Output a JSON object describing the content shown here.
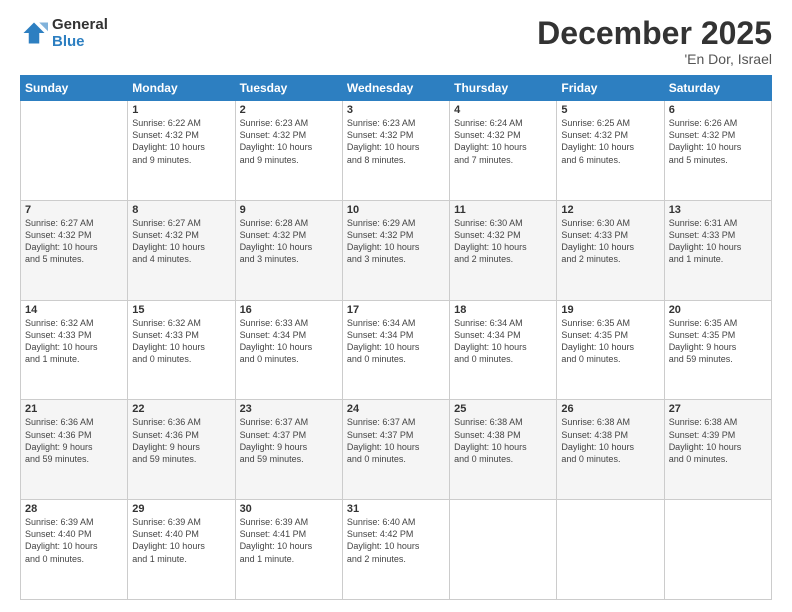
{
  "logo": {
    "line1": "General",
    "line2": "Blue"
  },
  "header": {
    "title": "December 2025",
    "location": "'En Dor, Israel"
  },
  "weekdays": [
    "Sunday",
    "Monday",
    "Tuesday",
    "Wednesday",
    "Thursday",
    "Friday",
    "Saturday"
  ],
  "weeks": [
    [
      {
        "day": "",
        "info": ""
      },
      {
        "day": "1",
        "info": "Sunrise: 6:22 AM\nSunset: 4:32 PM\nDaylight: 10 hours\nand 9 minutes."
      },
      {
        "day": "2",
        "info": "Sunrise: 6:23 AM\nSunset: 4:32 PM\nDaylight: 10 hours\nand 9 minutes."
      },
      {
        "day": "3",
        "info": "Sunrise: 6:23 AM\nSunset: 4:32 PM\nDaylight: 10 hours\nand 8 minutes."
      },
      {
        "day": "4",
        "info": "Sunrise: 6:24 AM\nSunset: 4:32 PM\nDaylight: 10 hours\nand 7 minutes."
      },
      {
        "day": "5",
        "info": "Sunrise: 6:25 AM\nSunset: 4:32 PM\nDaylight: 10 hours\nand 6 minutes."
      },
      {
        "day": "6",
        "info": "Sunrise: 6:26 AM\nSunset: 4:32 PM\nDaylight: 10 hours\nand 5 minutes."
      }
    ],
    [
      {
        "day": "7",
        "info": "Sunrise: 6:27 AM\nSunset: 4:32 PM\nDaylight: 10 hours\nand 5 minutes."
      },
      {
        "day": "8",
        "info": "Sunrise: 6:27 AM\nSunset: 4:32 PM\nDaylight: 10 hours\nand 4 minutes."
      },
      {
        "day": "9",
        "info": "Sunrise: 6:28 AM\nSunset: 4:32 PM\nDaylight: 10 hours\nand 3 minutes."
      },
      {
        "day": "10",
        "info": "Sunrise: 6:29 AM\nSunset: 4:32 PM\nDaylight: 10 hours\nand 3 minutes."
      },
      {
        "day": "11",
        "info": "Sunrise: 6:30 AM\nSunset: 4:32 PM\nDaylight: 10 hours\nand 2 minutes."
      },
      {
        "day": "12",
        "info": "Sunrise: 6:30 AM\nSunset: 4:33 PM\nDaylight: 10 hours\nand 2 minutes."
      },
      {
        "day": "13",
        "info": "Sunrise: 6:31 AM\nSunset: 4:33 PM\nDaylight: 10 hours\nand 1 minute."
      }
    ],
    [
      {
        "day": "14",
        "info": "Sunrise: 6:32 AM\nSunset: 4:33 PM\nDaylight: 10 hours\nand 1 minute."
      },
      {
        "day": "15",
        "info": "Sunrise: 6:32 AM\nSunset: 4:33 PM\nDaylight: 10 hours\nand 0 minutes."
      },
      {
        "day": "16",
        "info": "Sunrise: 6:33 AM\nSunset: 4:34 PM\nDaylight: 10 hours\nand 0 minutes."
      },
      {
        "day": "17",
        "info": "Sunrise: 6:34 AM\nSunset: 4:34 PM\nDaylight: 10 hours\nand 0 minutes."
      },
      {
        "day": "18",
        "info": "Sunrise: 6:34 AM\nSunset: 4:34 PM\nDaylight: 10 hours\nand 0 minutes."
      },
      {
        "day": "19",
        "info": "Sunrise: 6:35 AM\nSunset: 4:35 PM\nDaylight: 10 hours\nand 0 minutes."
      },
      {
        "day": "20",
        "info": "Sunrise: 6:35 AM\nSunset: 4:35 PM\nDaylight: 9 hours\nand 59 minutes."
      }
    ],
    [
      {
        "day": "21",
        "info": "Sunrise: 6:36 AM\nSunset: 4:36 PM\nDaylight: 9 hours\nand 59 minutes."
      },
      {
        "day": "22",
        "info": "Sunrise: 6:36 AM\nSunset: 4:36 PM\nDaylight: 9 hours\nand 59 minutes."
      },
      {
        "day": "23",
        "info": "Sunrise: 6:37 AM\nSunset: 4:37 PM\nDaylight: 9 hours\nand 59 minutes."
      },
      {
        "day": "24",
        "info": "Sunrise: 6:37 AM\nSunset: 4:37 PM\nDaylight: 10 hours\nand 0 minutes."
      },
      {
        "day": "25",
        "info": "Sunrise: 6:38 AM\nSunset: 4:38 PM\nDaylight: 10 hours\nand 0 minutes."
      },
      {
        "day": "26",
        "info": "Sunrise: 6:38 AM\nSunset: 4:38 PM\nDaylight: 10 hours\nand 0 minutes."
      },
      {
        "day": "27",
        "info": "Sunrise: 6:38 AM\nSunset: 4:39 PM\nDaylight: 10 hours\nand 0 minutes."
      }
    ],
    [
      {
        "day": "28",
        "info": "Sunrise: 6:39 AM\nSunset: 4:40 PM\nDaylight: 10 hours\nand 0 minutes."
      },
      {
        "day": "29",
        "info": "Sunrise: 6:39 AM\nSunset: 4:40 PM\nDaylight: 10 hours\nand 1 minute."
      },
      {
        "day": "30",
        "info": "Sunrise: 6:39 AM\nSunset: 4:41 PM\nDaylight: 10 hours\nand 1 minute."
      },
      {
        "day": "31",
        "info": "Sunrise: 6:40 AM\nSunset: 4:42 PM\nDaylight: 10 hours\nand 2 minutes."
      },
      {
        "day": "",
        "info": ""
      },
      {
        "day": "",
        "info": ""
      },
      {
        "day": "",
        "info": ""
      }
    ]
  ]
}
